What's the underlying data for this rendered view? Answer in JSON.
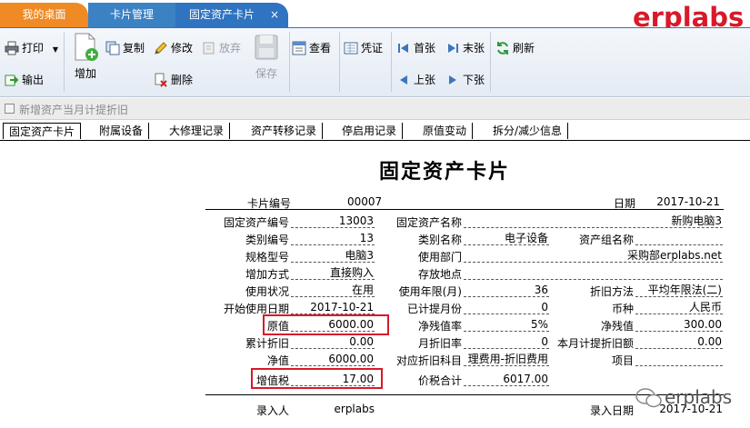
{
  "tabs": {
    "home": "我的桌面",
    "card_mgmt": "卡片管理",
    "active": "固定资产卡片",
    "close": "×"
  },
  "brand": "erplabs",
  "toolbar": {
    "print": "打印",
    "export": "输出",
    "add": "增加",
    "copy": "复制",
    "edit": "修改",
    "discard": "放弃",
    "delete": "删除",
    "save": "保存",
    "view": "查看",
    "voucher": "凭证",
    "first": "首张",
    "last": "末张",
    "prev": "上张",
    "next": "下张",
    "refresh": "刷新"
  },
  "option": {
    "label": "新增资产当月计提折旧",
    "checked": false
  },
  "subtabs": [
    "固定资产卡片",
    "附属设备",
    "大修理记录",
    "资产转移记录",
    "停启用记录",
    "原值变动",
    "拆分/减少信息"
  ],
  "card": {
    "title": "固定资产卡片",
    "card_no_label": "卡片编号",
    "card_no": "00007",
    "date_label": "日期",
    "date": "2017-10-21",
    "asset_no_label": "固定资产编号",
    "asset_no": "13003",
    "asset_name_label": "固定资产名称",
    "asset_name": "新购电脑3",
    "category_no_label": "类别编号",
    "category_no": "13",
    "category_name_label": "类别名称",
    "category_name": "电子设备",
    "group_label": "资产组名称",
    "group": "",
    "spec_label": "规格型号",
    "spec": "电脑3",
    "dept_label": "使用部门",
    "dept": "采购部erplabs.net",
    "add_method_label": "增加方式",
    "add_method": "直接购入",
    "location_label": "存放地点",
    "location": "",
    "status_label": "使用状况",
    "status": "在用",
    "life_label": "使用年限(月)",
    "life": "36",
    "dep_method_label": "折旧方法",
    "dep_method": "平均年限法(二)",
    "start_date_label": "开始使用日期",
    "start_date": "2017-10-21",
    "months_label": "已计提月份",
    "months": "0",
    "currency_label": "币种",
    "currency": "人民币",
    "orig_label": "原值",
    "orig": "6000.00",
    "salvage_rate_label": "净残值率",
    "salvage_rate": "5%",
    "salvage_label": "净残值",
    "salvage": "300.00",
    "acc_dep_label": "累计折旧",
    "acc_dep": "0.00",
    "month_rate_label": "月折旧率",
    "month_rate": "0",
    "month_dep_label": "本月计提折旧额",
    "month_dep": "0.00",
    "net_label": "净值",
    "net": "6000.00",
    "account_label": "对应折旧科目",
    "account": "理费用-折旧费用",
    "project_label": "项目",
    "project": "",
    "vat_label": "增值税",
    "vat": "17.00",
    "total_label": "价税合计",
    "total": "6017.00",
    "entered_by_label": "录入人",
    "entered_by": "erplabs",
    "entry_date_label": "录入日期",
    "entry_date": "2017-10-21"
  },
  "watermark": "erplabs",
  "colors": {
    "home_tab": "#f08a24",
    "active_tab": "#2f74c0",
    "highlight": "#d8192a"
  }
}
